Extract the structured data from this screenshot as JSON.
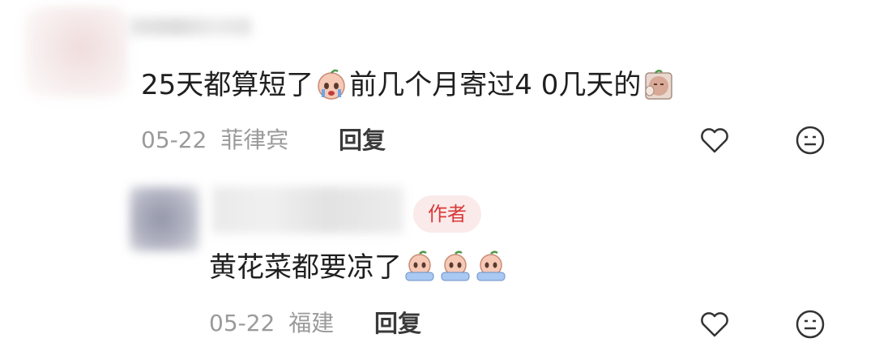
{
  "comments": [
    {
      "text_parts": [
        "25天都算短了",
        "前几个月寄过4 0几天的"
      ],
      "date": "05-22",
      "location": "菲律宾",
      "reply_label": "回复",
      "emojis": [
        "crying-emoji",
        "facepalm-emoji"
      ]
    },
    {
      "author_badge": "作者",
      "text": "黄花菜都要凉了",
      "date": "05-22",
      "location": "福建",
      "reply_label": "回复",
      "emojis": [
        "crying-emoji",
        "crying-emoji",
        "crying-emoji"
      ]
    }
  ],
  "icons": [
    "heart-icon",
    "neutral-face-icon"
  ]
}
